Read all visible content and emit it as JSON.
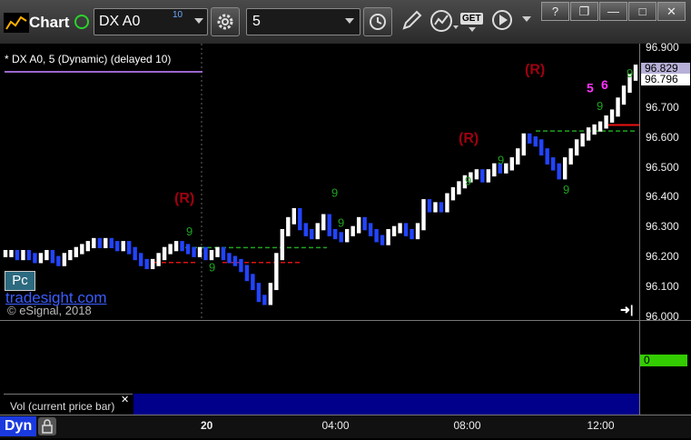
{
  "window": {
    "title": "Chart",
    "help_label": "?",
    "restore_label": "❐",
    "minimize_label": "—",
    "maximize_label": "□",
    "close_label": "✕"
  },
  "toolbar": {
    "symbol": "DX A0",
    "symbol_badge": "10",
    "interval": "5",
    "get_label": "GET"
  },
  "study": {
    "title": "* DX A0, 5 (Dynamic) (delayed 10)"
  },
  "watermark": {
    "badge": "Pc",
    "brand": "tradesight.com",
    "copyright": "© eSignal, 2018"
  },
  "price_tags": {
    "top": "96.829",
    "last": "96.796",
    "volume": "0",
    "top_color": "#b8b0d8",
    "last_color": "#ffffff",
    "volume_color": "#33cc00"
  },
  "volume_panel": {
    "label": "Vol (current price bar)",
    "close_label": "✕",
    "bar_color": "#00008a"
  },
  "x_axis": {
    "mode_label": "Dyn",
    "lock_icon": "lock-icon"
  },
  "chart_data": {
    "type": "line",
    "title": "",
    "ylim": [
      96.0,
      96.9
    ],
    "y_ticks": [
      "96.000",
      "96.100",
      "96.200",
      "96.300",
      "96.400",
      "96.500",
      "96.600",
      "96.700",
      "96.800",
      "96.900"
    ],
    "x_ticks": [
      "20",
      "04:00",
      "08:00",
      "12:00"
    ],
    "series": [
      {
        "values": [
          96.21,
          96.21,
          96.2,
          96.21,
          96.2,
          96.19,
          96.2,
          96.21,
          96.19,
          96.18,
          96.2,
          96.21,
          96.22,
          96.23,
          96.24,
          96.25,
          96.24,
          96.25,
          96.24,
          96.23,
          96.24,
          96.22,
          96.2,
          96.18,
          96.17,
          96.18,
          96.2,
          96.22,
          96.23,
          96.24,
          96.23,
          96.22,
          96.21,
          96.22,
          96.2,
          96.21,
          96.22,
          96.2,
          96.19,
          96.18,
          96.16,
          96.13,
          96.1,
          96.06,
          96.05,
          96.1,
          96.2,
          96.28,
          96.32,
          96.35,
          96.3,
          96.28,
          96.27,
          96.3,
          96.33,
          96.28,
          96.27,
          96.26,
          96.28,
          96.29,
          96.32,
          96.3,
          96.28,
          96.26,
          96.25,
          96.28,
          96.29,
          96.3,
          96.28,
          96.27,
          96.3,
          96.38,
          96.36,
          96.37,
          96.36,
          96.4,
          96.42,
          96.44,
          96.46,
          96.47,
          96.48,
          96.46,
          96.48,
          96.5,
          96.49,
          96.5,
          96.52,
          96.55,
          96.6,
          96.59,
          96.58,
          96.55,
          96.52,
          96.5,
          96.47,
          96.52,
          96.55,
          96.58,
          96.6,
          96.62,
          96.63,
          96.64,
          96.66,
          96.68,
          96.72,
          96.76,
          96.8,
          96.83
        ]
      }
    ],
    "annotations": [
      "(R)",
      "(R)",
      "(R)",
      "5",
      "6",
      "9"
    ]
  }
}
